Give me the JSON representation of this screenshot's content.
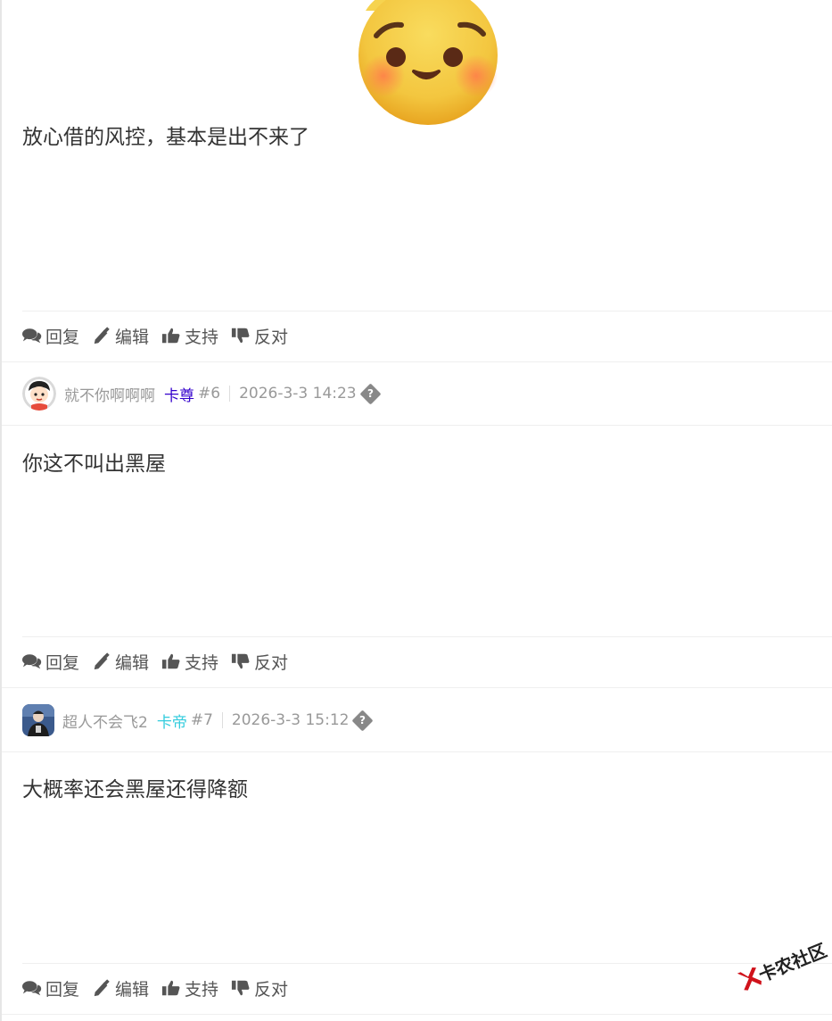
{
  "posts": [
    {
      "text": "放心借的风控，基本是出不来了",
      "actions": {
        "reply": "回复",
        "edit": "编辑",
        "support": "支持",
        "oppose": "反对"
      }
    },
    {
      "author": "就不你啊啊啊",
      "rank": "卡尊",
      "rank_color": "#3300cc",
      "floor": "#6",
      "time": "2026-3-3 14:23",
      "text": "你这不叫出黑屋",
      "actions": {
        "reply": "回复",
        "edit": "编辑",
        "support": "支持",
        "oppose": "反对"
      }
    },
    {
      "author": "超人不会飞2",
      "rank": "卡帝",
      "rank_color": "#33ccdd",
      "floor": "#7",
      "time": "2026-3-3 15:12",
      "text": "大概率还会黑屋还得降额",
      "actions": {
        "reply": "回复",
        "edit": "编辑",
        "support": "支持",
        "oppose": "反对"
      }
    }
  ],
  "watermark": "卡农社区",
  "icons": [
    "pleading-face-emoji",
    "comments-icon",
    "pencil-icon",
    "thumbs-up-icon",
    "thumbs-down-icon",
    "question-diamond-icon"
  ]
}
